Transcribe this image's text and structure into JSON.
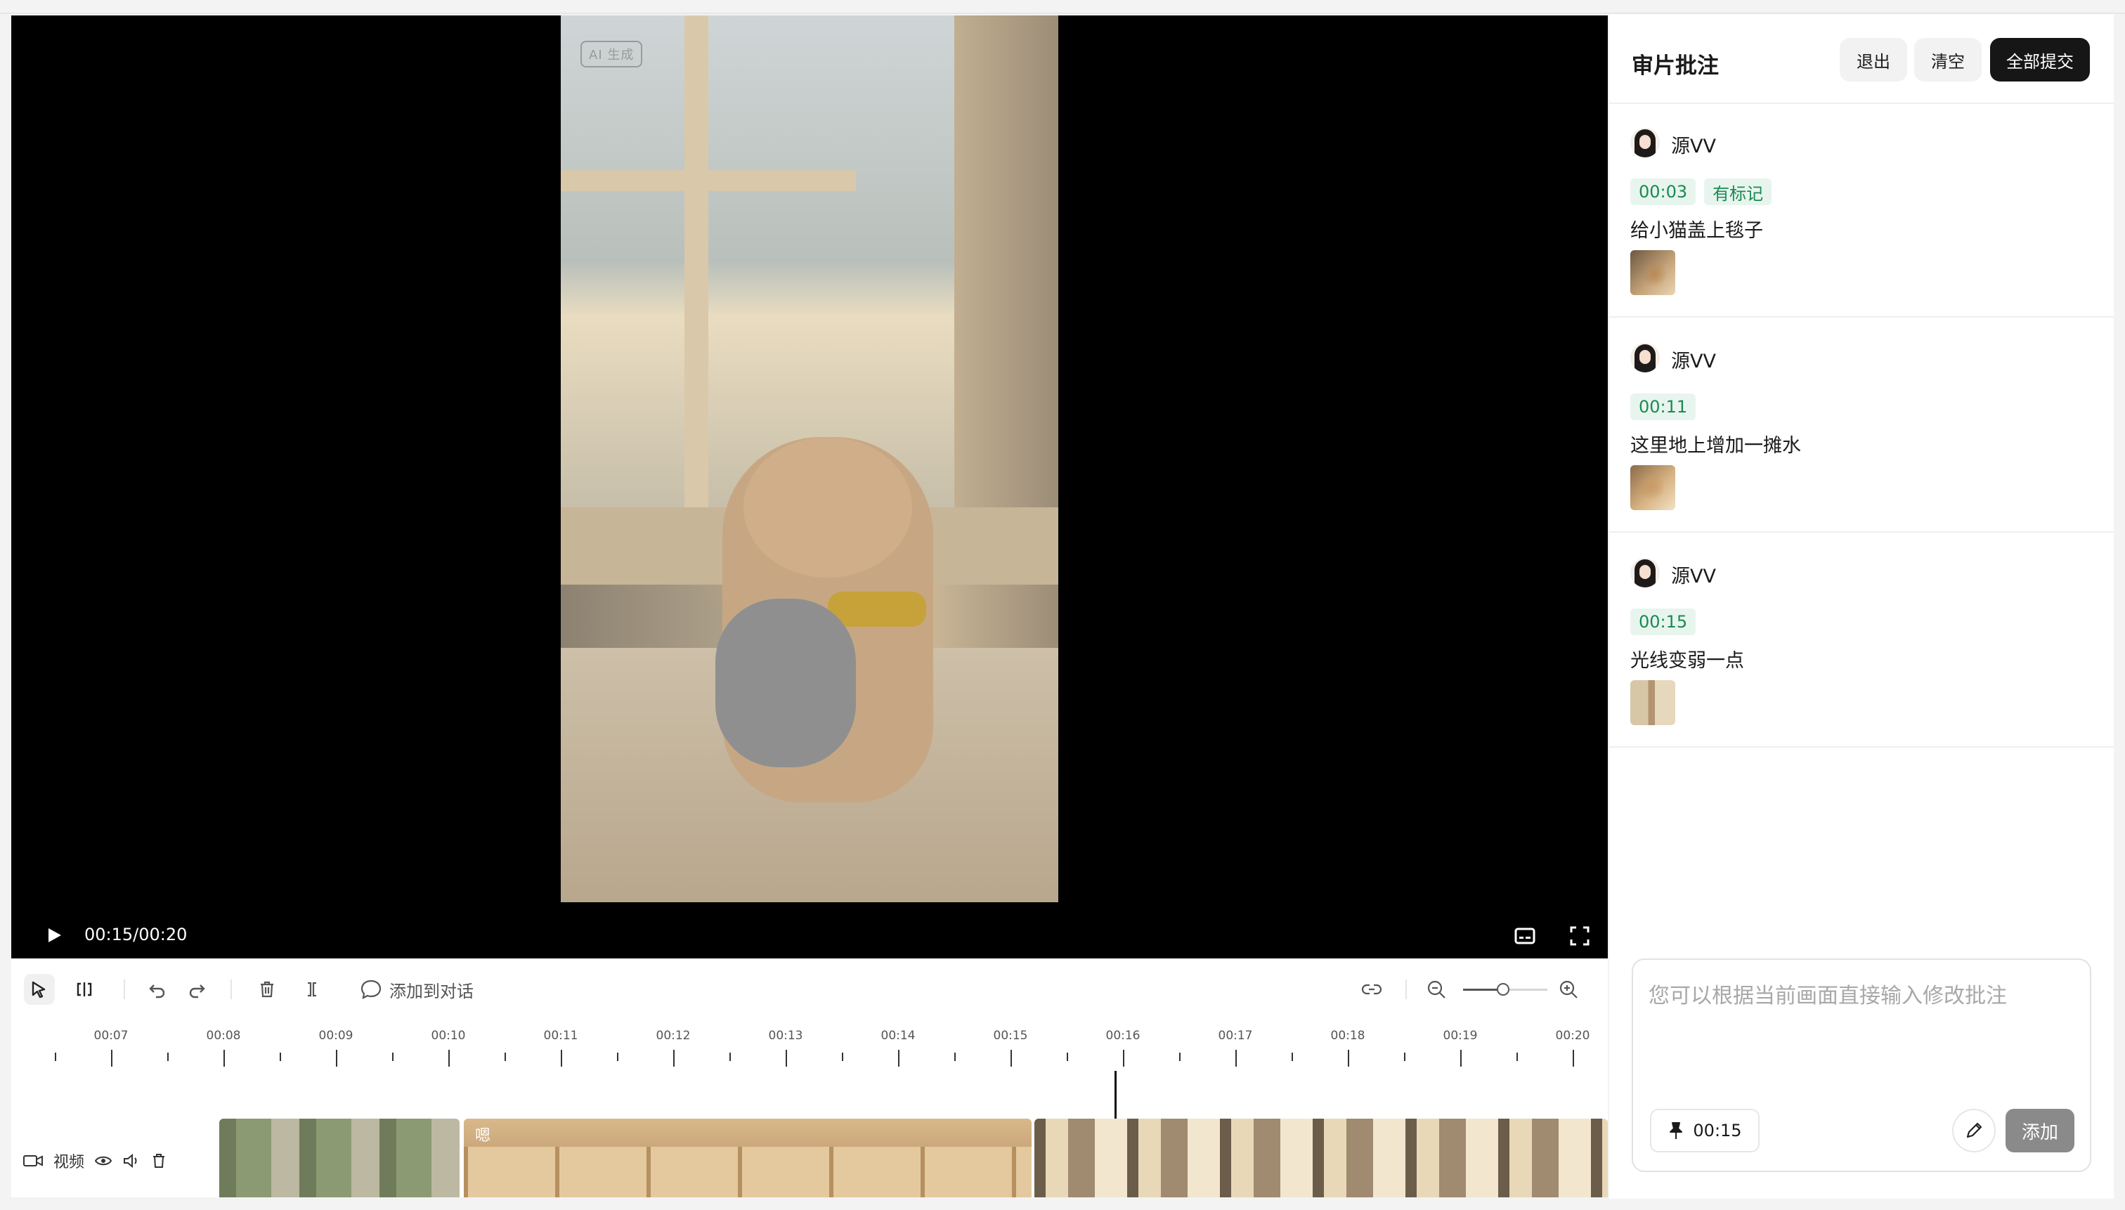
{
  "player": {
    "ai_tag": "AI 生成",
    "time": "00:15/00:20"
  },
  "toolbar": {
    "add_to_dialog": "添加到对话"
  },
  "timeline": {
    "ticks": [
      "00:07",
      "00:08",
      "00:09",
      "00:10",
      "00:11",
      "00:12",
      "00:13",
      "00:14",
      "00:15",
      "00:16",
      "00:17",
      "00:18",
      "00:19",
      "00:20"
    ],
    "track_label": "视频",
    "clip2_label": "嗯"
  },
  "panel": {
    "title": "审片批注",
    "exit_label": "退出",
    "clear_label": "清空",
    "submit_all_label": "全部提交",
    "comments": [
      {
        "author": "源VV",
        "time": "00:03",
        "marker": "有标记",
        "text": "给小猫盖上毯子"
      },
      {
        "author": "源VV",
        "time": "00:11",
        "text": "这里地上增加一摊水"
      },
      {
        "author": "源VV",
        "time": "00:15",
        "text": "光线变弱一点"
      }
    ]
  },
  "composer": {
    "placeholder": "您可以根据当前画面直接输入修改批注",
    "pin_time": "00:15",
    "add_label": "添加"
  },
  "colors": {
    "accent_green": "#1a8a52",
    "tag_bg": "#e8f5ee",
    "primary_dark": "#161616"
  },
  "icons": [
    "play-icon",
    "subtitle-icon",
    "fullscreen-icon",
    "select-arrow-icon",
    "split-icon",
    "undo-icon",
    "redo-icon",
    "trash-icon",
    "trim-icon",
    "comment-bubble-icon",
    "link-icon",
    "zoom-out-icon",
    "zoom-in-icon",
    "video-camera-icon",
    "eye-icon",
    "speaker-icon",
    "pin-icon",
    "pencil-icon"
  ]
}
